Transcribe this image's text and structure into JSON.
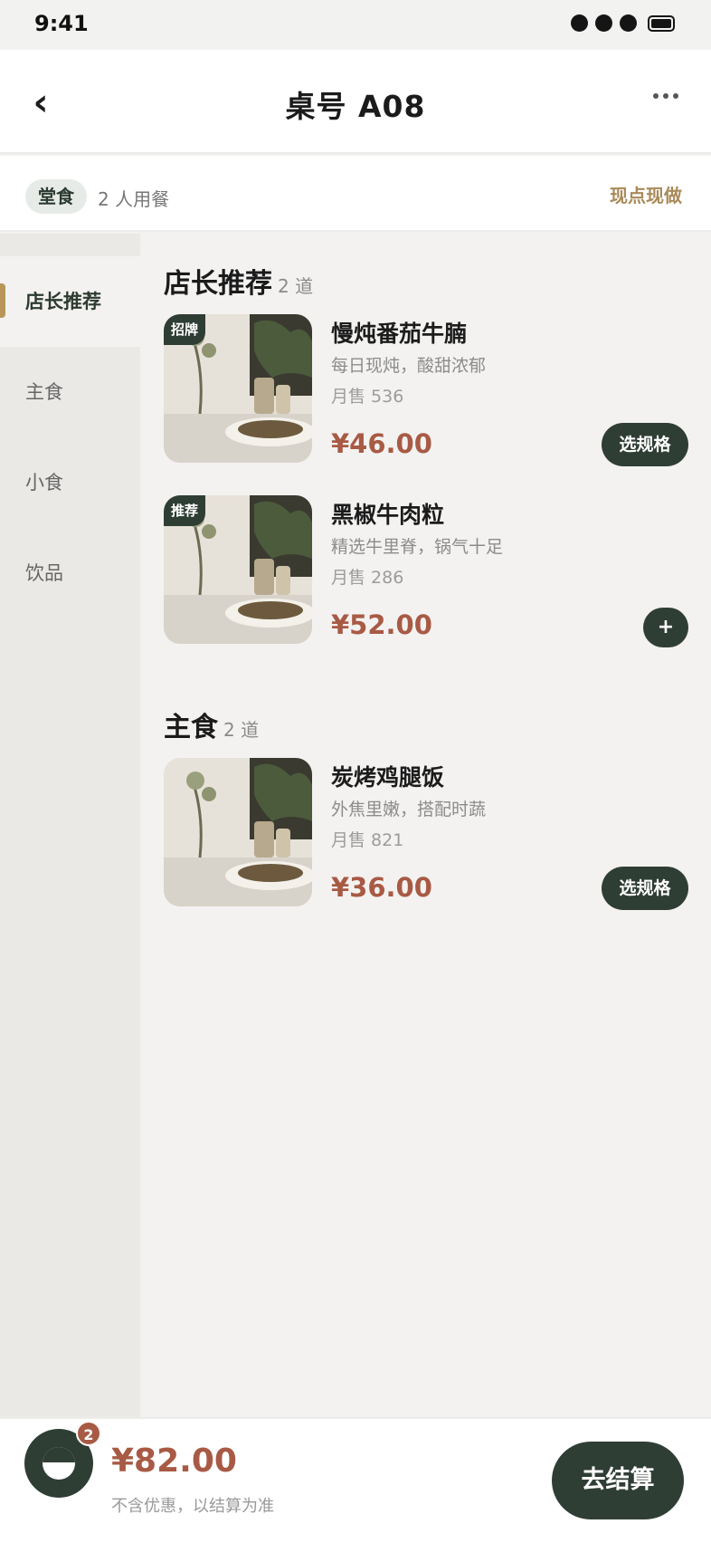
{
  "status_bar": {
    "time": "9:41"
  },
  "header": {
    "title": "桌号 A08",
    "back_icon": "‹"
  },
  "info": {
    "dine_type": "堂食",
    "diners": "2 人用餐",
    "fresh_label": "现点现做"
  },
  "sidebar": {
    "items": [
      {
        "label": "店长推荐",
        "active": true
      },
      {
        "label": "主食",
        "active": false
      },
      {
        "label": "小食",
        "active": false
      },
      {
        "label": "饮品",
        "active": false
      }
    ]
  },
  "sections": [
    {
      "title": "店长推荐",
      "count": "2 道",
      "dishes": [
        {
          "badge": "招牌",
          "name": "慢炖番茄牛腩",
          "desc": "每日现炖，酸甜浓郁",
          "sales": "月售 536",
          "price": "¥46.00",
          "action": "选规格"
        },
        {
          "badge": "推荐",
          "name": "黑椒牛肉粒",
          "desc": "精选牛里脊，锅气十足",
          "sales": "月售 286",
          "price": "¥52.00",
          "action": "+"
        }
      ]
    },
    {
      "title": "主食",
      "count": "2 道",
      "dishes": [
        {
          "badge": "",
          "name": "炭烤鸡腿饭",
          "desc": "外焦里嫩，搭配时蔬",
          "sales": "月售 821",
          "price": "¥36.00",
          "action": "选规格"
        }
      ]
    }
  ],
  "cart": {
    "count": "2",
    "total": "¥82.00",
    "note": "不含优惠，以结算为准",
    "checkout_label": "去结算"
  },
  "colors": {
    "primary": "#2f3e35",
    "price": "#a85a45",
    "accent": "#b8965a"
  }
}
